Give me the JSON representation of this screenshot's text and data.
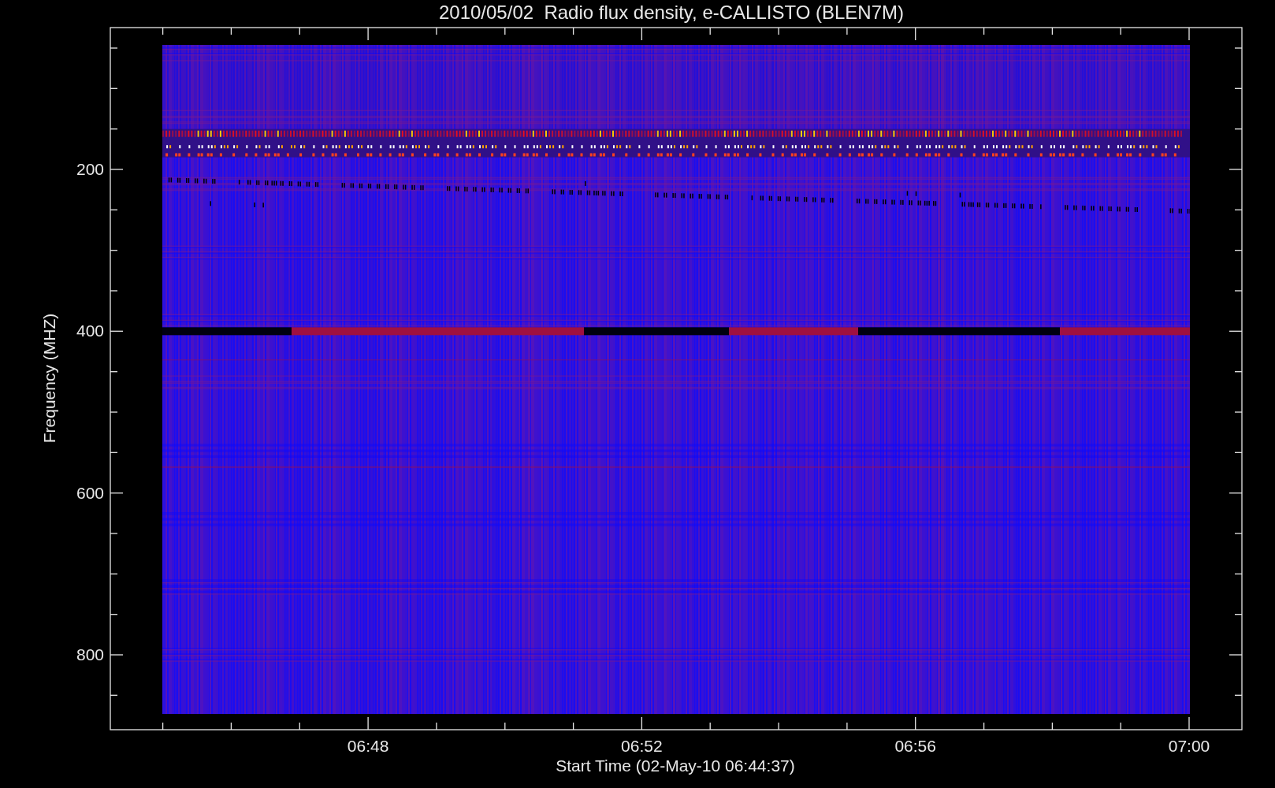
{
  "plot": {
    "title": "2010/05/02  Radio flux density, e-CALLISTO (BLEN7M)",
    "xlabel": "Start Time (02-May-10 06:44:37)",
    "ylabel": "Frequency (MHZ)",
    "xtick_labels": [
      "06:48",
      "06:52",
      "06:56",
      "07:00"
    ],
    "ytick_labels": [
      "200",
      "400",
      "600",
      "800"
    ]
  }
}
